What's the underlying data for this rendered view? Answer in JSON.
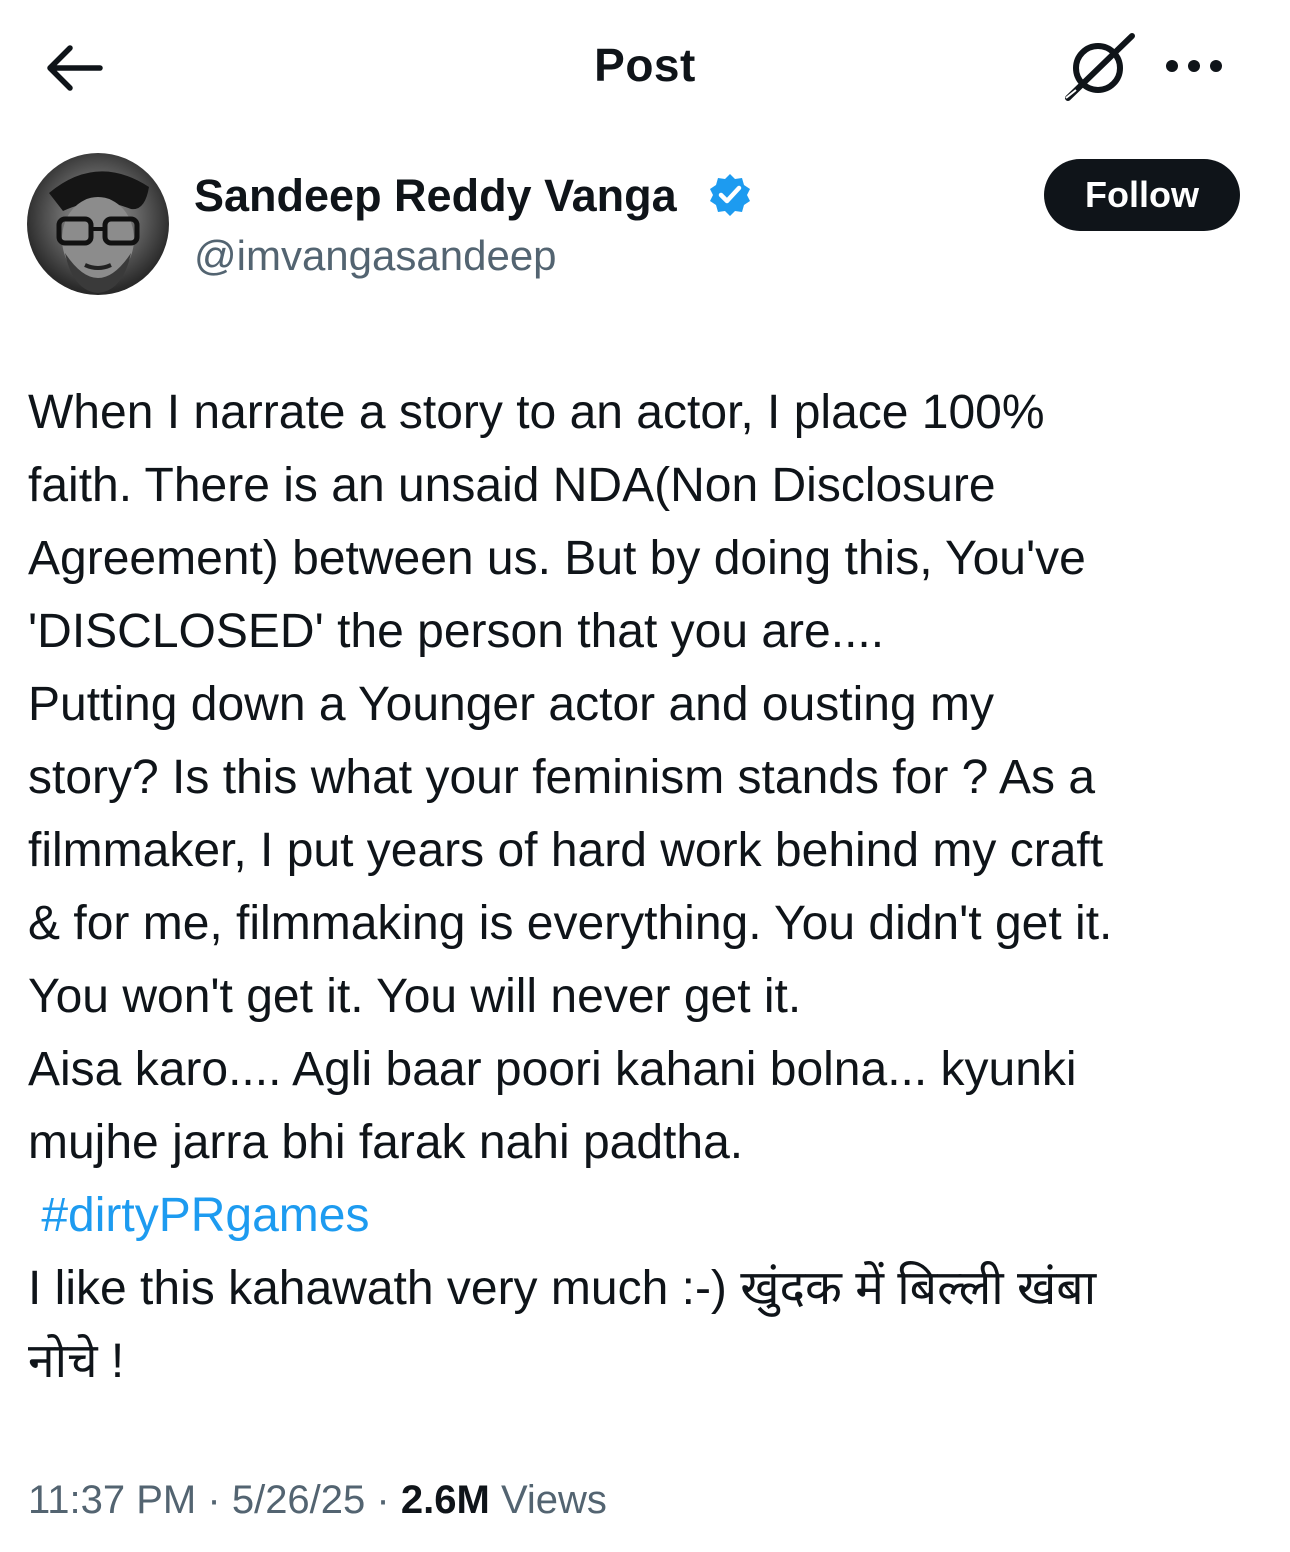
{
  "header": {
    "title": "Post",
    "back_icon": "arrow-left-icon",
    "grok_icon": "grok-icon",
    "more_icon": "more-horizontal-icon"
  },
  "author": {
    "display_name": "Sandeep Reddy Vanga",
    "handle": "@imvangasandeep",
    "verified": true,
    "verified_color": "#1d9bf0",
    "follow_label": "Follow"
  },
  "tweet": {
    "lines": [
      "When I narrate a story to an actor, I place 100%",
      "faith. There is an unsaid NDA(Non Disclosure",
      "Agreement) between us. But by doing this, You've",
      "'DISCLOSED' the person that you are....",
      "Putting down a Younger actor and ousting my",
      "story?  Is this what your feminism stands for ? As a",
      "filmmaker, I put years of hard work behind my craft",
      "& for me, filmmaking is everything. You didn't get it.",
      "You won't get it. You will never get it.",
      "Aisa karo.... Agli baar poori kahani bolna... kyunki",
      "mujhe jarra bhi farak nahi padtha."
    ],
    "hashtag": "#dirtyPRgames",
    "closing_lines": [
      "I like this kahawath very much :-) खुंदक में बिल्ली खंबा",
      "नोचे !"
    ],
    "hashtag_color": "#1d9bf0"
  },
  "meta": {
    "time": "11:37 PM",
    "separator": "·",
    "date": "5/26/25",
    "views_count": "2.6M",
    "views_label": "Views"
  }
}
